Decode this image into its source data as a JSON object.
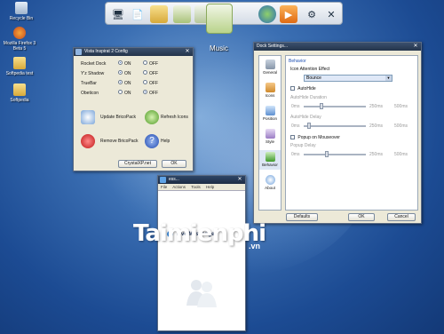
{
  "desktop": {
    "icons": [
      {
        "label": "Recycle Bin",
        "name": "recycle-bin-icon"
      },
      {
        "label": "Mozilla Firefox 3 Beta 5",
        "name": "firefox-icon"
      },
      {
        "label": "Softpedia test",
        "name": "folder-icon"
      },
      {
        "label": "Softpedia",
        "name": "folder-icon"
      }
    ]
  },
  "dock": {
    "music_label": "Music"
  },
  "config_window": {
    "title": "Vista Inspirat 2 Config",
    "options": [
      {
        "label": "Rocket Dock",
        "on": "ON",
        "off": "OFF",
        "selected": "on"
      },
      {
        "label": "Y'z Shadow",
        "on": "ON",
        "off": "OFF",
        "selected": "on"
      },
      {
        "label": "TrueBar",
        "on": "ON",
        "off": "OFF",
        "selected": "on"
      },
      {
        "label": "Obeticon",
        "on": "ON",
        "off": "OFF",
        "selected": "off"
      }
    ],
    "actions": {
      "update": "Update BricoPack",
      "refresh": "Refresh Icons",
      "remove": "Remove BricoPack",
      "help": "Help"
    },
    "site_button": "CrystalXP.net",
    "ok_button": "OK"
  },
  "dock_settings": {
    "title": "Dock Settings...",
    "nav": [
      "General",
      "Icons",
      "Position",
      "Style",
      "Behavior",
      "About"
    ],
    "section_heading": "Behavior",
    "effect_label": "Icon Attention Effect",
    "effect_value": "Bounce",
    "autohide_label": "AutoHide",
    "autohide_duration_label": "AutoHide Duration",
    "autohide_delay_label": "AutoHide Delay",
    "popup_label": "Popup on Mouseover",
    "popup_delay_label": "Popup Delay",
    "slider_min_labels": [
      "0ms",
      "0ms",
      "0ms"
    ],
    "slider_mid_labels": [
      "250ms",
      "250ms",
      "250ms"
    ],
    "slider_max_labels": [
      "500ms",
      "500ms",
      "500ms"
    ],
    "defaults_button": "Defaults",
    "ok_button": "OK",
    "cancel_button": "Cancel"
  },
  "messenger": {
    "title": "ess...",
    "menus": [
      "File",
      "Actions",
      "Tools",
      "Help"
    ],
    "service_label": "Live Messenger"
  },
  "watermark": {
    "brand": "Taimienphi",
    "domain": ".vn"
  },
  "colors": {
    "desktop_blue": "#1c4b93",
    "title_dark": "#24344b",
    "window_face": "#ece9d8"
  }
}
